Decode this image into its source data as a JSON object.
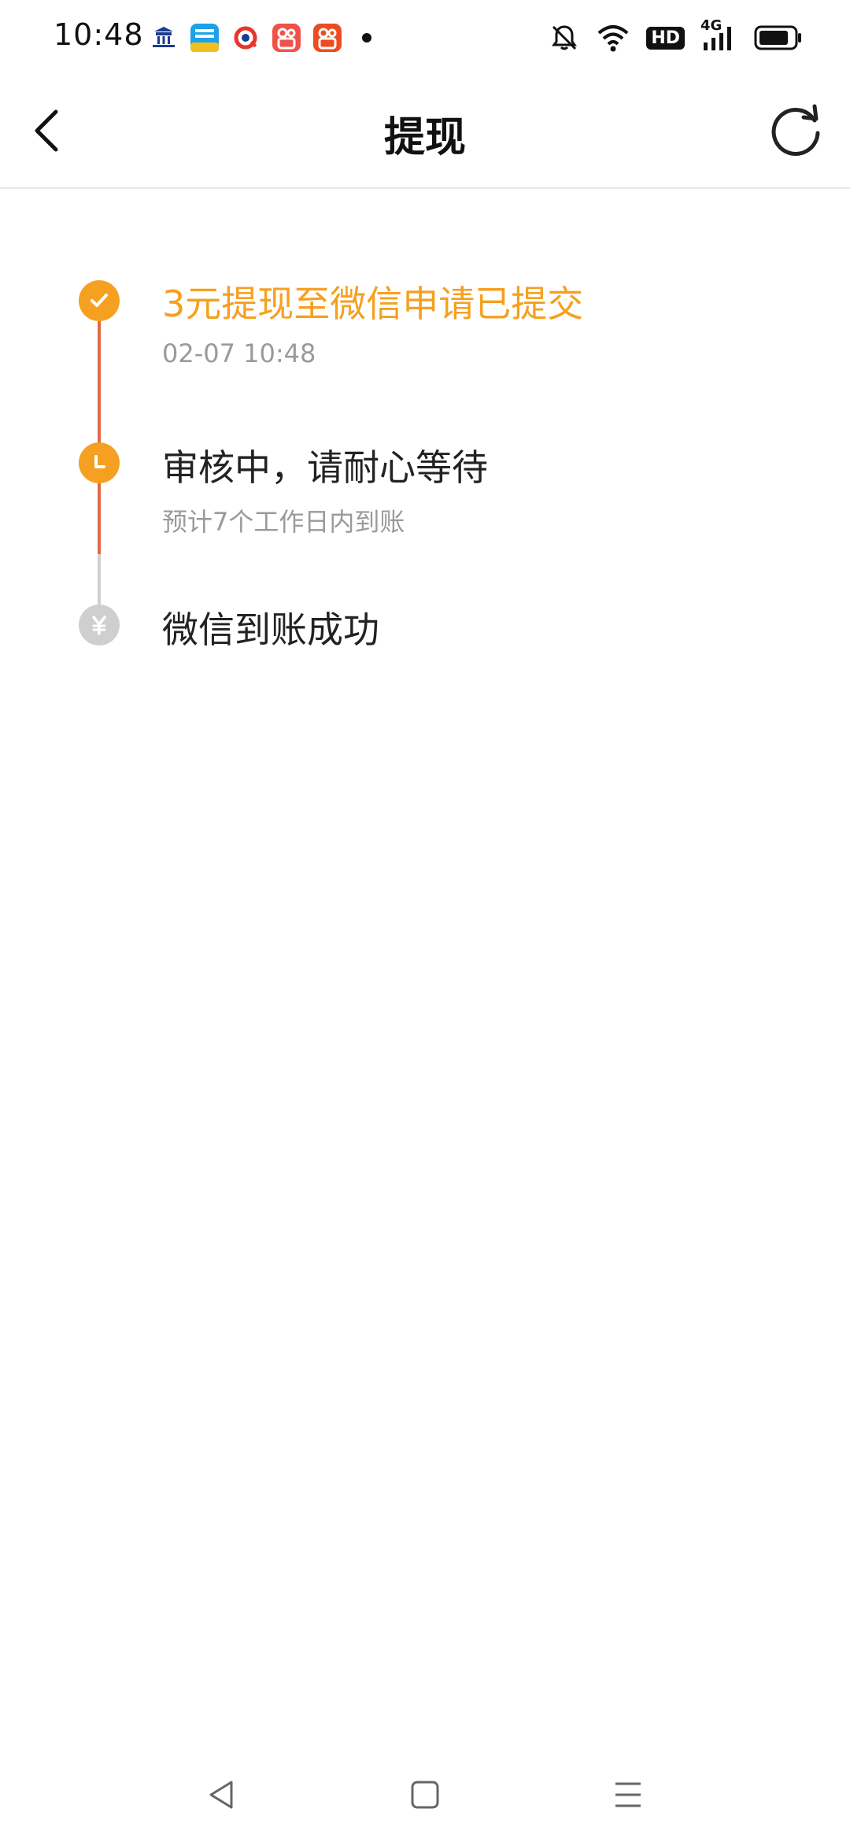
{
  "status_bar": {
    "time": "10:48",
    "notification_icons": [
      "palace-app-icon",
      "news-app-icon",
      "search-app-icon",
      "kuaishou-app-icon",
      "kuaishou-app-icon-2"
    ],
    "right_icons": [
      "mute-bell-icon",
      "wifi-icon",
      "hd-icon",
      "signal-4g-icon",
      "battery-icon"
    ],
    "hd_label": "HD",
    "network_label": "4G"
  },
  "app_bar": {
    "title": "提现"
  },
  "timeline": {
    "steps": [
      {
        "title": "3元提现至微信申请已提交",
        "subtitle": "02-07 10:48",
        "state": "done",
        "icon": "check-icon"
      },
      {
        "title": "审核中，请耐心等待",
        "subtitle": "预计7个工作日内到账",
        "state": "current",
        "icon": "clock-icon"
      },
      {
        "title": "微信到账成功",
        "state": "future",
        "icon": "yuan-icon"
      }
    ]
  },
  "colors": {
    "accent": "#f5a020",
    "line_active": "#e06b47",
    "line_pending": "#d0d0d0",
    "inactive_dot": "#cfcfcf",
    "subtitle": "#9a9a9a"
  }
}
